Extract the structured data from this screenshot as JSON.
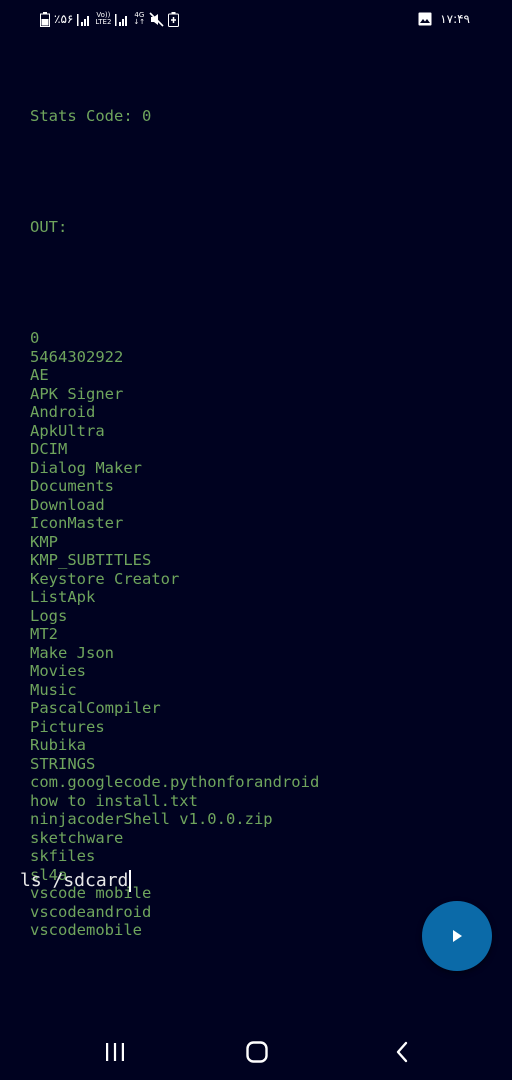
{
  "status_bar": {
    "battery_percent": "٪۵۶",
    "volte_top": "Vo))",
    "volte_bottom": "LTE2",
    "network_type": "4G",
    "network_arrows": "↓↑",
    "time": "۱۷:۴۹",
    "icons": [
      "battery-icon",
      "signal-icon",
      "volte-icon",
      "signal-icon",
      "4g-icon",
      "mute-icon",
      "battery-saver-icon",
      "image-notification-icon"
    ]
  },
  "terminal": {
    "stats_code": "Stats Code: 0",
    "out_label": "OUT:",
    "output_lines": [
      "0",
      "5464302922",
      "AE",
      "APK Signer",
      "Android",
      "ApkUltra",
      "DCIM",
      "Dialog Maker",
      "Documents",
      "Download",
      "IconMaster",
      "KMP",
      "KMP_SUBTITLES",
      "Keystore Creator",
      "ListApk",
      "Logs",
      "MT2",
      "Make Json",
      "Movies",
      "Music",
      "PascalCompiler",
      "Pictures",
      "Rubika",
      "STRINGS",
      "com.googlecode.pythonforandroid",
      "how to install.txt",
      "ninjacoderShell v1.0.0.zip",
      "sketchware",
      "skfiles",
      "sl4a",
      "vscode mobile",
      "vscodeandroid",
      "vscodemobile"
    ],
    "command": "ls /sdcard"
  },
  "run_button": {
    "icon": "play-icon",
    "color": "#0b6aa8"
  },
  "nav_bar": {
    "recents_icon": "recents-icon",
    "home_icon": "home-icon",
    "back_icon": "back-icon"
  },
  "colors": {
    "background": "#000220",
    "output_text": "#6fa55d",
    "input_text": "#e8e8e8"
  }
}
